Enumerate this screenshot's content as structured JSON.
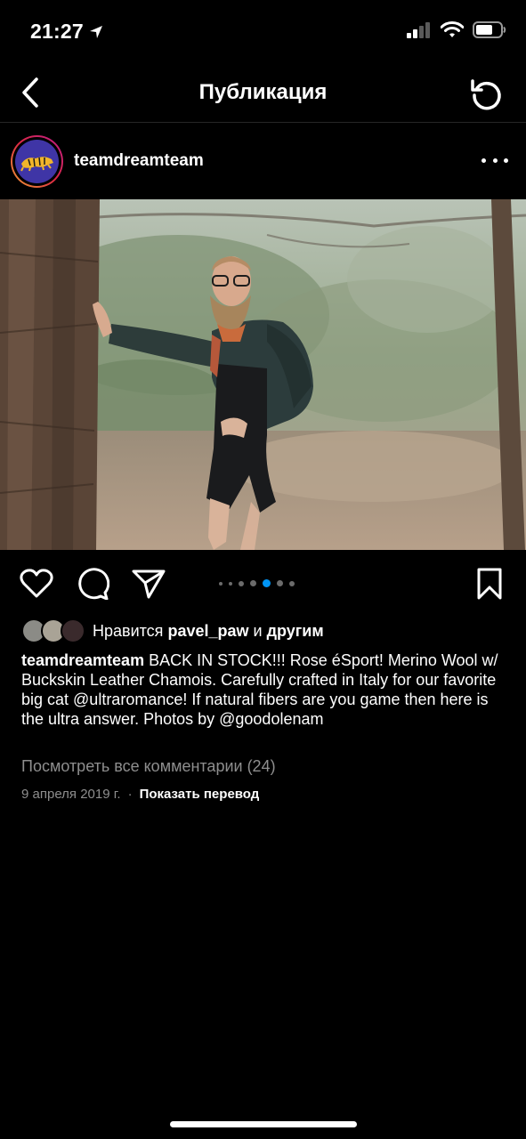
{
  "status": {
    "time": "21:27"
  },
  "nav": {
    "title": "Публикация"
  },
  "post": {
    "username": "teamdreamteam",
    "carousel": {
      "total": 7,
      "active_index": 4
    },
    "likes": {
      "prefix": "Нравится",
      "user": "pavel_paw",
      "and": "и",
      "others": "другим"
    },
    "caption": {
      "username": "teamdreamteam",
      "text": " BACK IN STOCK!!! Rose éSport! Merino Wool w/ Buckskin Leather Chamois. Carefully crafted in Italy for our favorite big cat @ultraromance! If natural fibers are you game then here is the ultra answer. Photos by @goodolenam"
    },
    "comments_link": "Посмотреть все комментарии (24)",
    "date": "9 апреля 2019 г.",
    "separator": "·",
    "translate": "Показать перевод"
  },
  "icons": [
    "location-arrow-icon",
    "signal-icon",
    "wifi-icon",
    "battery-icon",
    "back-icon",
    "refresh-icon",
    "more-icon",
    "heart-icon",
    "comment-icon",
    "share-icon",
    "bookmark-icon"
  ]
}
